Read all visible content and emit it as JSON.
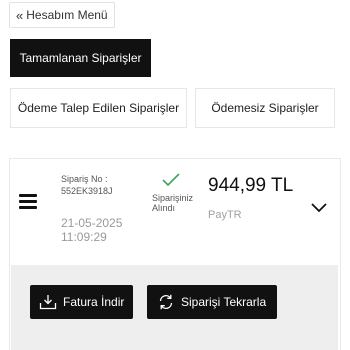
{
  "header": {
    "back_icon": "«",
    "back_label": "Hesabım Menü"
  },
  "tabs": [
    {
      "label": "Tamamlanan Siparişler",
      "active": true
    },
    {
      "label": "Ödeme Talep Edilen Siparişler",
      "active": false
    },
    {
      "label": "Ödemesiz Siparişler",
      "active": false
    }
  ],
  "order": {
    "number_label": "Sipariş No :",
    "number": "552EK3918J",
    "date": "21-05-2025 11:09:29",
    "status": "Siparişiniz Alındı",
    "amount": "944,99 TL",
    "payment_method": "PayTR"
  },
  "actions": {
    "invoice_label": "Fatura İndir",
    "repeat_label": "Siparişi Tekrarla"
  },
  "colors": {
    "dark": "#111111",
    "check_green": "#3fa55b",
    "panel_bg": "#eeeeee"
  }
}
